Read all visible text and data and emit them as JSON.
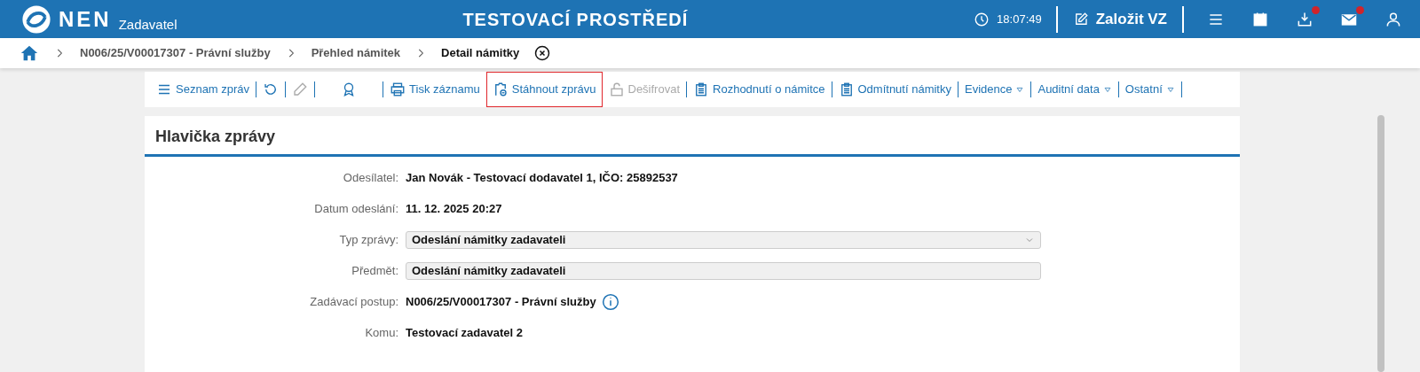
{
  "top_bar": {
    "logo": "NEN",
    "role": "Zadavatel",
    "title": "TESTOVACÍ PROSTŘEDÍ",
    "time": "18:07:49",
    "create_button": "Založit VZ",
    "icons": [
      {
        "badge": false
      },
      {
        "badge": false
      },
      {
        "badge": true
      },
      {
        "badge": true
      },
      {
        "badge": false
      }
    ]
  },
  "breadcrumb": [
    {
      "label": "N006/25/V00017307 - Právní služby",
      "selected": false
    },
    {
      "label": "Přehled námitek",
      "selected": false
    },
    {
      "label": "Detail námitky",
      "selected": true
    }
  ],
  "toolbar": [
    {
      "label": "Seznam zpráv",
      "disabled": false,
      "highlighted": false,
      "dropdown": false
    },
    {
      "disabled": false,
      "highlighted": false,
      "dropdown": false
    },
    {
      "disabled": true,
      "highlighted": false,
      "dropdown": false
    },
    {
      "disabled": false,
      "highlighted": false,
      "dropdown": false
    },
    {
      "label": "Tisk záznamu",
      "disabled": false,
      "highlighted": false,
      "dropdown": false
    },
    {
      "label": "Stáhnout zprávu",
      "disabled": false,
      "highlighted": true,
      "dropdown": false
    },
    {
      "label": "Dešifrovat",
      "disabled": true,
      "highlighted": false,
      "dropdown": false
    },
    {
      "label": "Rozhodnutí o námitce",
      "disabled": false,
      "highlighted": false,
      "dropdown": false
    },
    {
      "label": "Odmítnutí námitky",
      "disabled": false,
      "highlighted": false,
      "dropdown": false
    },
    {
      "label": "Evidence",
      "disabled": false,
      "highlighted": false,
      "dropdown": true
    },
    {
      "label": "Auditní data",
      "disabled": false,
      "highlighted": false,
      "dropdown": true
    },
    {
      "label": "Ostatní",
      "disabled": false,
      "highlighted": false,
      "dropdown": true
    }
  ],
  "panel": {
    "title": "Hlavička zprávy",
    "fields": [
      {
        "kind": "text",
        "label": "Odesílatel:",
        "value": "Jan Novák - Testovací dodavatel 1, IČO: 25892537"
      },
      {
        "kind": "text",
        "label": "Datum odeslání:",
        "value": "11. 12. 2025 20:27"
      },
      {
        "kind": "select",
        "label": "Typ zprávy:",
        "value": "Odeslání námitky zadavateli"
      },
      {
        "kind": "input",
        "label": "Předmět:",
        "value": "Odeslání námitky zadavateli"
      },
      {
        "kind": "info",
        "label": "Zadávací postup:",
        "value": "N006/25/V00017307 - Právní služby"
      },
      {
        "kind": "text",
        "label": "Komu:",
        "value": "Testovací zadavatel 2"
      }
    ]
  }
}
